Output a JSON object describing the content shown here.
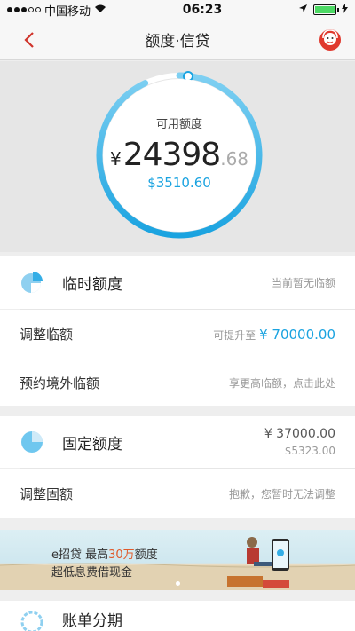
{
  "status": {
    "carrier": "中国移动",
    "time": "06:23"
  },
  "nav": {
    "title": "额度·信贷"
  },
  "credit": {
    "label": "可用额度",
    "currency": "¥",
    "amount_int": "24398",
    "amount_dec": ".68",
    "usd": "$3510.60",
    "ring_fill": 0.93
  },
  "temp_limit": {
    "title": "临时额度",
    "status": "当前暂无临额"
  },
  "adjust_temp": {
    "label": "调整临额",
    "prefix": "可提升至",
    "value": "¥ 70000.00"
  },
  "reserve_overseas": {
    "label": "预约境外临额",
    "hint": "享更高临额，点击此处"
  },
  "fixed_limit": {
    "title": "固定额度",
    "cny": "¥ 37000.00",
    "usd": "$5323.00"
  },
  "adjust_fixed": {
    "label": "调整固额",
    "hint": "抱歉，您暂时无法调整"
  },
  "banner": {
    "line1_a": "e招贷  最高",
    "line1_hl": "30万",
    "line1_b": "额度",
    "line2": "超低息费借现金"
  },
  "installment": {
    "title": "账单分期"
  },
  "colors": {
    "accent": "#1aa3e0",
    "ring_start": "#7fd0f2",
    "ring_end": "#1aa3e0",
    "back": "#d0342c"
  }
}
